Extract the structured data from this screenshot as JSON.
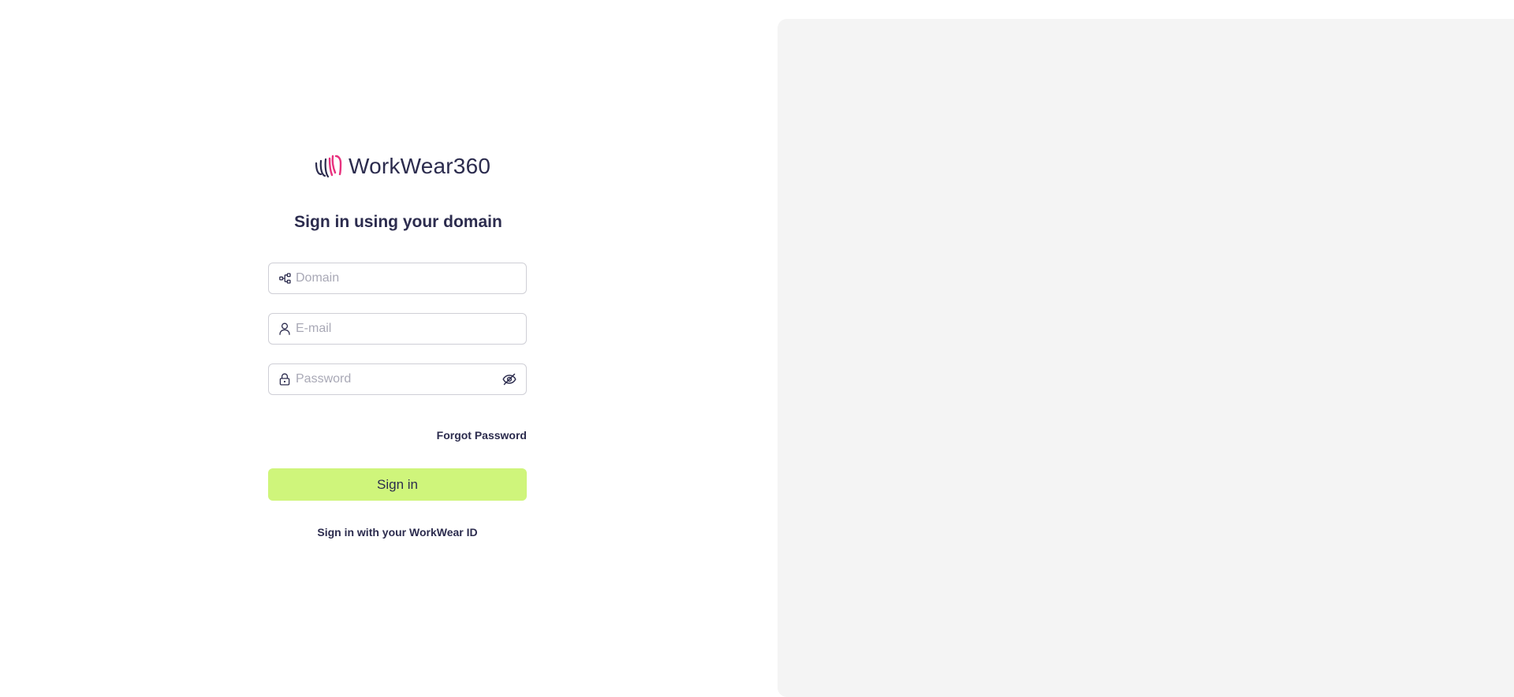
{
  "brand": {
    "name": "WorkWear360",
    "logo_icon": "workwear-hand-logo-icon",
    "colors": {
      "accent": "#e8317e",
      "text": "#2c2c4e",
      "button": "#cff57b",
      "panel": "#f4f4f4"
    }
  },
  "form": {
    "heading": "Sign in using your domain",
    "domain": {
      "icon": "hierarchy-icon",
      "placeholder": "Domain",
      "value": ""
    },
    "email": {
      "icon": "user-icon",
      "placeholder": "E-mail",
      "value": ""
    },
    "password": {
      "icon": "lock-icon",
      "placeholder": "Password",
      "value": "",
      "toggle_icon": "eye-off-icon"
    },
    "forgot_label": "Forgot Password",
    "submit_label": "Sign in",
    "alt_signin_label": "Sign in with your WorkWear ID"
  }
}
